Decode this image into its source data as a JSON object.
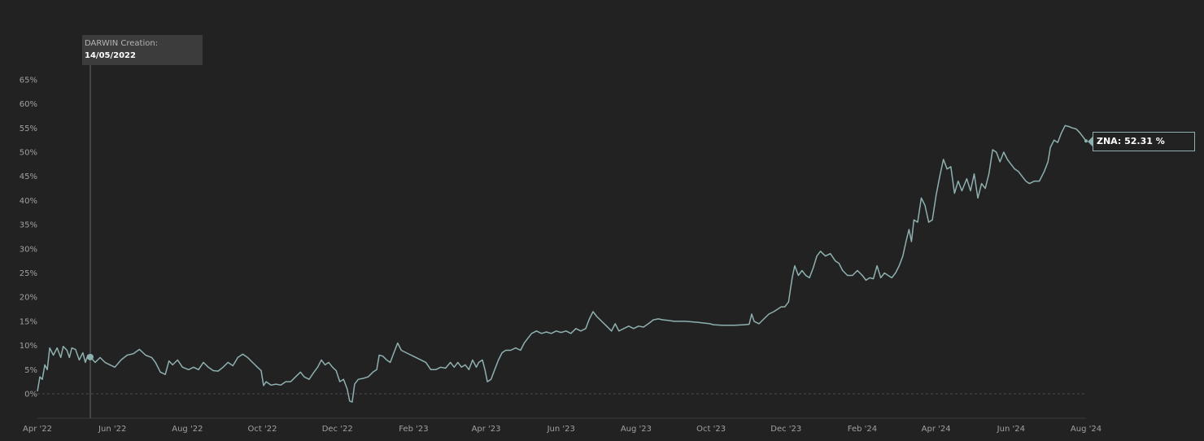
{
  "chart_data": {
    "type": "line",
    "x_unit": "date",
    "y_unit": "percent",
    "xlim": [
      "2022-04-01",
      "2024-08-01"
    ],
    "ylim": [
      -5,
      65
    ],
    "y_ticks": [
      0,
      5,
      10,
      15,
      20,
      25,
      30,
      35,
      40,
      45,
      50,
      55,
      60,
      65
    ],
    "y_tick_labels": [
      "0%",
      "5%",
      "10%",
      "15%",
      "20%",
      "25%",
      "30%",
      "35%",
      "40%",
      "45%",
      "50%",
      "55%",
      "60%",
      "65%"
    ],
    "x_ticks": [
      "2022-04-01",
      "2022-06-01",
      "2022-08-01",
      "2022-10-01",
      "2022-12-01",
      "2023-02-01",
      "2023-04-01",
      "2023-06-01",
      "2023-08-01",
      "2023-10-01",
      "2023-12-01",
      "2024-02-01",
      "2024-04-01",
      "2024-06-01",
      "2024-08-01"
    ],
    "x_tick_labels": [
      "Apr '22",
      "Jun '22",
      "Aug '22",
      "Oct '22",
      "Dec '22",
      "Feb '23",
      "Apr '23",
      "Jun '23",
      "Aug '23",
      "Oct '23",
      "Dec '23",
      "Feb '24",
      "Apr '24",
      "Jun '24",
      "Aug '24"
    ],
    "grid": "zero-line dashed",
    "series": [
      {
        "color": "#8fb0b0",
        "points": [
          [
            "2022-04-01",
            0.5
          ],
          [
            "2022-04-03",
            3.5
          ],
          [
            "2022-04-05",
            3.0
          ],
          [
            "2022-04-07",
            6.0
          ],
          [
            "2022-04-09",
            5.0
          ],
          [
            "2022-04-11",
            9.5
          ],
          [
            "2022-04-14",
            8.0
          ],
          [
            "2022-04-17",
            9.5
          ],
          [
            "2022-04-20",
            7.5
          ],
          [
            "2022-04-22",
            9.8
          ],
          [
            "2022-04-25",
            9.0
          ],
          [
            "2022-04-27",
            7.5
          ],
          [
            "2022-04-29",
            9.5
          ],
          [
            "2022-05-02",
            9.2
          ],
          [
            "2022-05-05",
            7.0
          ],
          [
            "2022-05-08",
            8.5
          ],
          [
            "2022-05-10",
            6.5
          ],
          [
            "2022-05-12",
            8.0
          ],
          [
            "2022-05-14",
            7.6
          ],
          [
            "2022-05-18",
            6.5
          ],
          [
            "2022-05-22",
            7.5
          ],
          [
            "2022-05-26",
            6.5
          ],
          [
            "2022-05-30",
            6.0
          ],
          [
            "2022-06-03",
            5.5
          ],
          [
            "2022-06-08",
            7.0
          ],
          [
            "2022-06-13",
            8.0
          ],
          [
            "2022-06-18",
            8.3
          ],
          [
            "2022-06-23",
            9.2
          ],
          [
            "2022-06-28",
            8.0
          ],
          [
            "2022-07-03",
            7.5
          ],
          [
            "2022-07-06",
            6.5
          ],
          [
            "2022-07-10",
            4.5
          ],
          [
            "2022-07-14",
            4.0
          ],
          [
            "2022-07-17",
            6.8
          ],
          [
            "2022-07-20",
            6.0
          ],
          [
            "2022-07-24",
            7.0
          ],
          [
            "2022-07-28",
            5.5
          ],
          [
            "2022-08-02",
            5.0
          ],
          [
            "2022-08-06",
            5.5
          ],
          [
            "2022-08-10",
            5.0
          ],
          [
            "2022-08-14",
            6.5
          ],
          [
            "2022-08-18",
            5.5
          ],
          [
            "2022-08-22",
            4.8
          ],
          [
            "2022-08-26",
            4.7
          ],
          [
            "2022-08-30",
            5.5
          ],
          [
            "2022-09-03",
            6.5
          ],
          [
            "2022-09-07",
            5.8
          ],
          [
            "2022-09-11",
            7.5
          ],
          [
            "2022-09-15",
            8.2
          ],
          [
            "2022-09-19",
            7.5
          ],
          [
            "2022-09-23",
            6.5
          ],
          [
            "2022-09-27",
            5.5
          ],
          [
            "2022-09-30",
            4.8
          ],
          [
            "2022-10-02",
            1.7
          ],
          [
            "2022-10-04",
            2.5
          ],
          [
            "2022-10-08",
            1.8
          ],
          [
            "2022-10-12",
            2.0
          ],
          [
            "2022-10-16",
            1.8
          ],
          [
            "2022-10-20",
            2.5
          ],
          [
            "2022-10-24",
            2.5
          ],
          [
            "2022-10-28",
            3.5
          ],
          [
            "2022-11-01",
            4.5
          ],
          [
            "2022-11-04",
            3.5
          ],
          [
            "2022-11-08",
            3.0
          ],
          [
            "2022-11-12",
            4.5
          ],
          [
            "2022-11-15",
            5.5
          ],
          [
            "2022-11-18",
            7.0
          ],
          [
            "2022-11-21",
            6.0
          ],
          [
            "2022-11-24",
            6.5
          ],
          [
            "2022-11-27",
            5.5
          ],
          [
            "2022-11-30",
            4.8
          ],
          [
            "2022-12-03",
            2.5
          ],
          [
            "2022-12-06",
            3.0
          ],
          [
            "2022-12-09",
            1.0
          ],
          [
            "2022-12-11",
            -1.5
          ],
          [
            "2022-12-13",
            -1.7
          ],
          [
            "2022-12-15",
            2.0
          ],
          [
            "2022-12-18",
            3.0
          ],
          [
            "2022-12-22",
            3.2
          ],
          [
            "2022-12-26",
            3.5
          ],
          [
            "2022-12-30",
            4.5
          ],
          [
            "2023-01-02",
            5.0
          ],
          [
            "2023-01-04",
            8.0
          ],
          [
            "2023-01-07",
            7.8
          ],
          [
            "2023-01-10",
            7.0
          ],
          [
            "2023-01-13",
            6.5
          ],
          [
            "2023-01-16",
            8.5
          ],
          [
            "2023-01-19",
            10.5
          ],
          [
            "2023-01-22",
            9.0
          ],
          [
            "2023-01-26",
            8.5
          ],
          [
            "2023-01-30",
            8.0
          ],
          [
            "2023-02-03",
            7.5
          ],
          [
            "2023-02-07",
            7.0
          ],
          [
            "2023-02-11",
            6.5
          ],
          [
            "2023-02-15",
            5.0
          ],
          [
            "2023-02-19",
            5.0
          ],
          [
            "2023-02-23",
            5.5
          ],
          [
            "2023-02-27",
            5.3
          ],
          [
            "2023-03-03",
            6.5
          ],
          [
            "2023-03-06",
            5.5
          ],
          [
            "2023-03-09",
            6.5
          ],
          [
            "2023-03-12",
            5.5
          ],
          [
            "2023-03-15",
            6.0
          ],
          [
            "2023-03-18",
            5.0
          ],
          [
            "2023-03-21",
            7.0
          ],
          [
            "2023-03-24",
            5.5
          ],
          [
            "2023-03-26",
            6.5
          ],
          [
            "2023-03-29",
            7.0
          ],
          [
            "2023-03-31",
            5.0
          ],
          [
            "2023-04-02",
            2.5
          ],
          [
            "2023-04-05",
            3.0
          ],
          [
            "2023-04-08",
            5.0
          ],
          [
            "2023-04-11",
            7.0
          ],
          [
            "2023-04-14",
            8.5
          ],
          [
            "2023-04-17",
            9.0
          ],
          [
            "2023-04-21",
            9.0
          ],
          [
            "2023-04-25",
            9.5
          ],
          [
            "2023-04-29",
            9.0
          ],
          [
            "2023-05-02",
            10.5
          ],
          [
            "2023-05-05",
            11.5
          ],
          [
            "2023-05-08",
            12.5
          ],
          [
            "2023-05-12",
            13.0
          ],
          [
            "2023-05-16",
            12.5
          ],
          [
            "2023-05-20",
            12.8
          ],
          [
            "2023-05-24",
            12.5
          ],
          [
            "2023-05-28",
            13.0
          ],
          [
            "2023-06-01",
            12.7
          ],
          [
            "2023-06-05",
            13.0
          ],
          [
            "2023-06-09",
            12.5
          ],
          [
            "2023-06-13",
            13.5
          ],
          [
            "2023-06-17",
            13.0
          ],
          [
            "2023-06-21",
            13.5
          ],
          [
            "2023-06-24",
            15.5
          ],
          [
            "2023-06-27",
            17.0
          ],
          [
            "2023-06-30",
            16.0
          ],
          [
            "2023-07-04",
            15.0
          ],
          [
            "2023-07-08",
            14.0
          ],
          [
            "2023-07-12",
            13.0
          ],
          [
            "2023-07-15",
            14.5
          ],
          [
            "2023-07-18",
            13.0
          ],
          [
            "2023-07-22",
            13.5
          ],
          [
            "2023-07-26",
            14.0
          ],
          [
            "2023-07-30",
            13.5
          ],
          [
            "2023-08-03",
            14.0
          ],
          [
            "2023-08-07",
            13.8
          ],
          [
            "2023-08-11",
            14.5
          ],
          [
            "2023-08-15",
            15.3
          ],
          [
            "2023-08-19",
            15.5
          ],
          [
            "2023-08-23",
            15.3
          ],
          [
            "2023-08-27",
            15.2
          ],
          [
            "2023-09-01",
            15.0
          ],
          [
            "2023-09-10",
            15.0
          ],
          [
            "2023-09-20",
            14.8
          ],
          [
            "2023-09-30",
            14.5
          ],
          [
            "2023-10-03",
            14.3
          ],
          [
            "2023-10-10",
            14.2
          ],
          [
            "2023-10-20",
            14.2
          ],
          [
            "2023-10-28",
            14.3
          ],
          [
            "2023-11-01",
            14.4
          ],
          [
            "2023-11-03",
            16.5
          ],
          [
            "2023-11-05",
            15.0
          ],
          [
            "2023-11-09",
            14.5
          ],
          [
            "2023-11-13",
            15.5
          ],
          [
            "2023-11-17",
            16.5
          ],
          [
            "2023-11-21",
            17.0
          ],
          [
            "2023-11-24",
            17.5
          ],
          [
            "2023-11-27",
            18.0
          ],
          [
            "2023-11-30",
            18.0
          ],
          [
            "2023-12-03",
            19.0
          ],
          [
            "2023-12-06",
            24.0
          ],
          [
            "2023-12-08",
            26.5
          ],
          [
            "2023-12-11",
            24.5
          ],
          [
            "2023-12-14",
            25.5
          ],
          [
            "2023-12-17",
            24.5
          ],
          [
            "2023-12-20",
            24.0
          ],
          [
            "2023-12-23",
            26.0
          ],
          [
            "2023-12-26",
            28.5
          ],
          [
            "2023-12-29",
            29.5
          ],
          [
            "2024-01-02",
            28.5
          ],
          [
            "2024-01-06",
            29.0
          ],
          [
            "2024-01-10",
            27.5
          ],
          [
            "2024-01-13",
            27.0
          ],
          [
            "2024-01-16",
            25.5
          ],
          [
            "2024-01-20",
            24.5
          ],
          [
            "2024-01-24",
            24.5
          ],
          [
            "2024-01-28",
            25.5
          ],
          [
            "2024-02-01",
            24.5
          ],
          [
            "2024-02-04",
            23.5
          ],
          [
            "2024-02-07",
            24.0
          ],
          [
            "2024-02-10",
            23.8
          ],
          [
            "2024-02-13",
            26.5
          ],
          [
            "2024-02-16",
            24.0
          ],
          [
            "2024-02-19",
            25.0
          ],
          [
            "2024-02-22",
            24.5
          ],
          [
            "2024-02-25",
            24.0
          ],
          [
            "2024-02-28",
            25.0
          ],
          [
            "2024-03-02",
            26.5
          ],
          [
            "2024-03-05",
            28.5
          ],
          [
            "2024-03-08",
            32.0
          ],
          [
            "2024-03-10",
            34.0
          ],
          [
            "2024-03-12",
            31.5
          ],
          [
            "2024-03-14",
            36.0
          ],
          [
            "2024-03-17",
            35.5
          ],
          [
            "2024-03-20",
            40.5
          ],
          [
            "2024-03-23",
            39.0
          ],
          [
            "2024-03-26",
            35.5
          ],
          [
            "2024-03-29",
            36.0
          ],
          [
            "2024-04-01",
            41.0
          ],
          [
            "2024-04-04",
            45.0
          ],
          [
            "2024-04-07",
            48.5
          ],
          [
            "2024-04-10",
            46.5
          ],
          [
            "2024-04-13",
            47.0
          ],
          [
            "2024-04-16",
            41.5
          ],
          [
            "2024-04-19",
            44.0
          ],
          [
            "2024-04-22",
            42.0
          ],
          [
            "2024-04-26",
            44.5
          ],
          [
            "2024-04-29",
            42.0
          ],
          [
            "2024-05-02",
            45.5
          ],
          [
            "2024-05-05",
            40.5
          ],
          [
            "2024-05-08",
            43.5
          ],
          [
            "2024-05-11",
            42.5
          ],
          [
            "2024-05-14",
            45.5
          ],
          [
            "2024-05-17",
            50.5
          ],
          [
            "2024-05-20",
            50.0
          ],
          [
            "2024-05-23",
            48.0
          ],
          [
            "2024-05-26",
            50.0
          ],
          [
            "2024-05-29",
            48.5
          ],
          [
            "2024-06-01",
            47.5
          ],
          [
            "2024-06-04",
            46.5
          ],
          [
            "2024-06-07",
            46.0
          ],
          [
            "2024-06-10",
            45.0
          ],
          [
            "2024-06-13",
            44.0
          ],
          [
            "2024-06-16",
            43.5
          ],
          [
            "2024-06-20",
            44.0
          ],
          [
            "2024-06-24",
            44.0
          ],
          [
            "2024-06-28",
            46.0
          ],
          [
            "2024-07-01",
            48.0
          ],
          [
            "2024-07-03",
            51.0
          ],
          [
            "2024-07-06",
            52.5
          ],
          [
            "2024-07-09",
            52.0
          ],
          [
            "2024-07-12",
            54.0
          ],
          [
            "2024-07-15",
            55.5
          ],
          [
            "2024-07-18",
            55.3
          ],
          [
            "2024-07-21",
            55.0
          ],
          [
            "2024-07-24",
            54.8
          ],
          [
            "2024-07-27",
            54.0
          ],
          [
            "2024-07-30",
            53.0
          ],
          [
            "2024-08-01",
            52.31
          ]
        ]
      }
    ],
    "marker": {
      "date": "2022-05-14",
      "value": 7.6,
      "title": "DARWIN Creation:",
      "date_label": "14/05/2022"
    },
    "last_value": {
      "label": "ZNA: 52.31 %",
      "value": 52.31
    }
  }
}
